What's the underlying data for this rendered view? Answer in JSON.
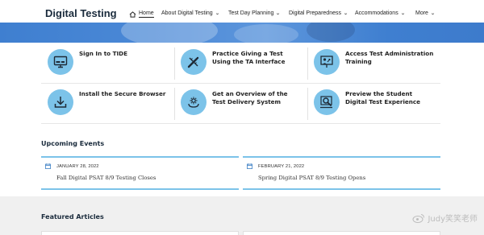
{
  "site": {
    "title": "Digital Testing"
  },
  "nav": {
    "home": "Home",
    "items": [
      {
        "label": "About Digital Testing"
      },
      {
        "label": "Test Day Planning"
      },
      {
        "label": "Digital Preparedness"
      },
      {
        "label": "Accommodations"
      },
      {
        "label": "More"
      }
    ]
  },
  "quick_links": [
    {
      "label": "Sign In to TIDE",
      "icon": "monitor-icon"
    },
    {
      "label": "Practice Giving a Test Using the TA Interface",
      "icon": "pencil-ruler-icon"
    },
    {
      "label": "Access Test Administration Training",
      "icon": "presentation-icon"
    },
    {
      "label": "Install the Secure Browser",
      "icon": "download-icon"
    },
    {
      "label": "Get an Overview of the Test Delivery System",
      "icon": "gear-hand-icon"
    },
    {
      "label": "Preview the Student Digital Test Experience",
      "icon": "magnifier-icon"
    }
  ],
  "upcoming": {
    "title": "Upcoming Events",
    "events": [
      {
        "date": "JANUARY 28, 2022",
        "title": "Fall Digital PSAT 8/9 Testing Closes"
      },
      {
        "date": "FEBRUARY 21, 2022",
        "title": "Spring Digital PSAT 8/9 Testing Opens"
      }
    ]
  },
  "featured": {
    "title": "Featured Articles"
  },
  "watermark": {
    "text": "Judy笑笑老师"
  },
  "colors": {
    "accent": "#7cc3e9",
    "banner": "#4a88d6",
    "featured_bg": "#f0f0f0"
  }
}
